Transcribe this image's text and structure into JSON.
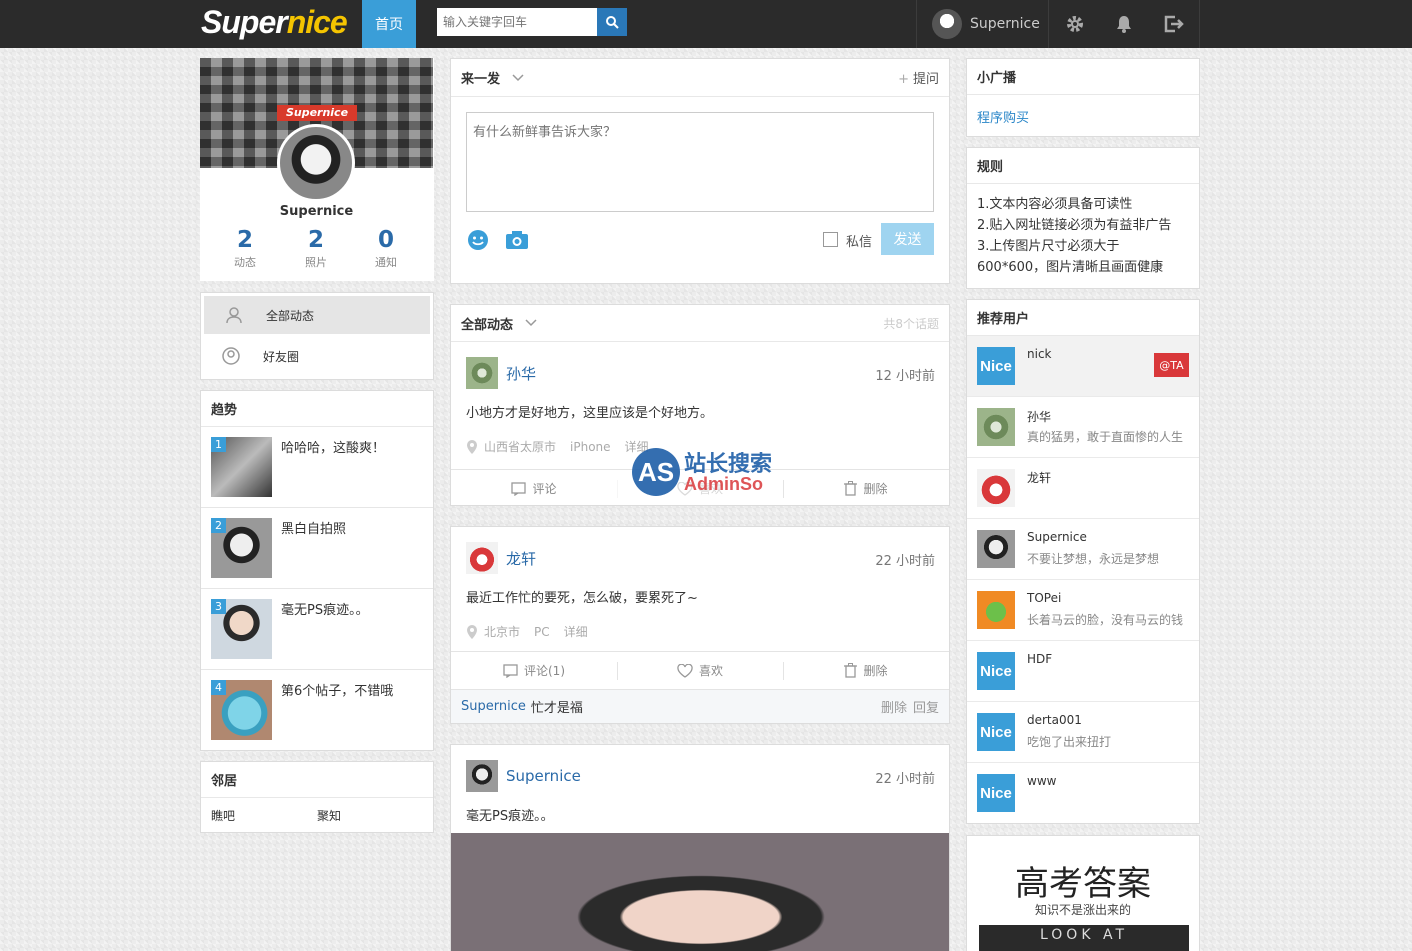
{
  "header": {
    "logo_part1": "Super",
    "logo_part2": "nice",
    "home_label": "首页",
    "search_placeholder": "输入关键字回车",
    "username": "Supernice",
    "icons": [
      "search-icon",
      "gear-icon",
      "bell-icon",
      "logout-icon"
    ]
  },
  "profile": {
    "cover_tag": "Supernice",
    "name": "Supernice",
    "stats": [
      {
        "value": "2",
        "label": "动态"
      },
      {
        "value": "2",
        "label": "照片"
      },
      {
        "value": "0",
        "label": "通知"
      }
    ]
  },
  "left_nav": {
    "items": [
      {
        "label": "全部动态",
        "icon": "user-icon",
        "active": true
      },
      {
        "label": "好友圈",
        "icon": "circle-user-icon",
        "active": false
      }
    ]
  },
  "trends": {
    "title": "趋势",
    "items": [
      {
        "rank": "1",
        "text": "哈哈哈，这酸爽！"
      },
      {
        "rank": "2",
        "text": "黑白自拍照"
      },
      {
        "rank": "3",
        "text": "毫无PS痕迹。。"
      },
      {
        "rank": "4",
        "text": "第6个帖子，不错哦"
      }
    ]
  },
  "neighbors": {
    "title": "邻居",
    "links": [
      "瞧吧",
      "聚知"
    ]
  },
  "compose": {
    "title": "来一发",
    "ask_label": "提问",
    "placeholder": "有什么新鲜事告诉大家？",
    "private_label": "私信",
    "send_label": "发送"
  },
  "feed": {
    "title": "全部动态",
    "count_label": "共8个话题",
    "posts": [
      {
        "name": "孙华",
        "time": "12 小时前",
        "body": "小地方才是好地方，这里应该是个好地方。",
        "location": "山西省太原市",
        "device": "iPhone",
        "detail": "详细",
        "comment_label": "评论",
        "like_label": "喜欢",
        "delete_label": "删除"
      },
      {
        "name": "龙轩",
        "time": "22 小时前",
        "body": "最近工作忙的要死，怎么破，要累死了~",
        "location": "北京市",
        "device": "PC",
        "detail": "详细",
        "comment_label": "评论(1)",
        "like_label": "喜欢",
        "delete_label": "删除",
        "comment": {
          "user": "Supernice",
          "text": "忙才是福",
          "delete": "删除",
          "reply": "回复"
        }
      },
      {
        "name": "Supernice",
        "time": "22 小时前",
        "body": "毫无PS痕迹。。"
      }
    ]
  },
  "broadcast": {
    "title": "小广播",
    "link": "程序购买"
  },
  "rules": {
    "title": "规则",
    "lines": [
      "1.文本内容必须具备可读性",
      "2.贴入网址链接必须为有益非广告",
      "3.上传图片尺寸必须大于",
      "600*600，图片清晰且画面健康"
    ]
  },
  "recommend": {
    "title": "推荐用户",
    "follow_label": "@TA",
    "users": [
      {
        "name": "nick",
        "sub": "",
        "avatar": "Nice"
      },
      {
        "name": "孙华",
        "sub": "真的猛男，敢于直面惨的人生",
        "avatar": ""
      },
      {
        "name": "龙轩",
        "sub": "",
        "avatar": ""
      },
      {
        "name": "Supernice",
        "sub": "不要让梦想，永远是梦想",
        "avatar": ""
      },
      {
        "name": "TOPei",
        "sub": "长着马云的脸，没有马云的钱",
        "avatar": ""
      },
      {
        "name": "HDF",
        "sub": "",
        "avatar": "Nice"
      },
      {
        "name": "derta001",
        "sub": "吃饱了出来扭打",
        "avatar": "Nice"
      },
      {
        "name": "www",
        "sub": "",
        "avatar": "Nice"
      }
    ]
  },
  "ad": {
    "title": "高考答案",
    "subtitle": "知识不是涨出来的",
    "banner": "LOOK AT"
  },
  "watermark": {
    "brand": "AS",
    "cn": "站长搜索",
    "en": "AdminSo"
  }
}
